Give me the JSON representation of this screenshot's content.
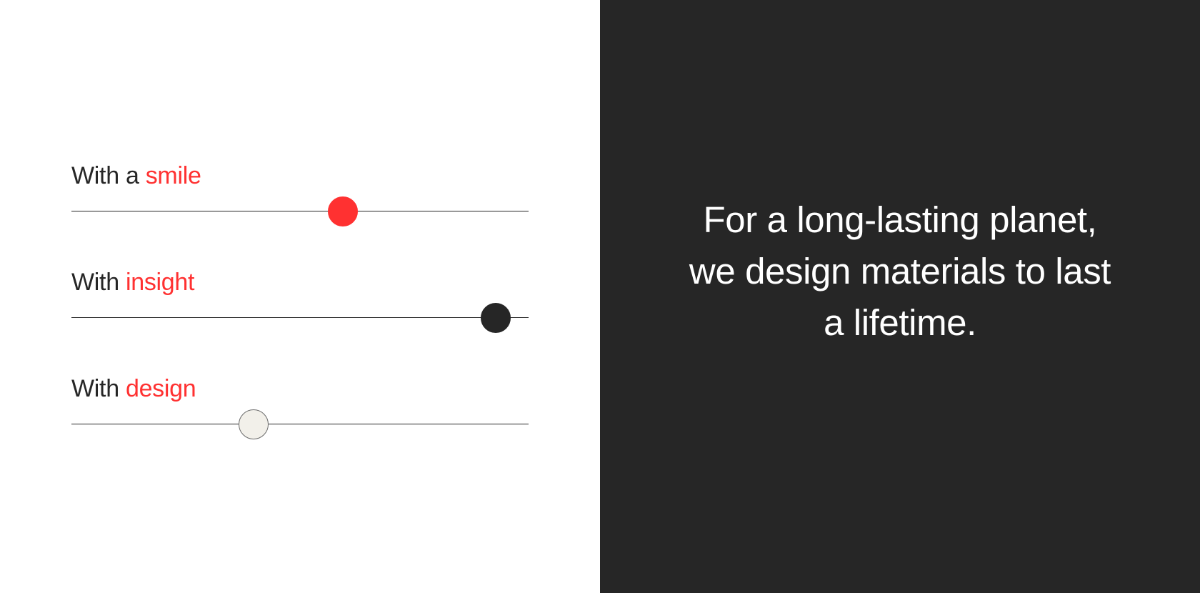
{
  "sliders": [
    {
      "prefix": "With a",
      "accent_word": "smile",
      "value_percent": 59.3,
      "thumb_color": "#ff3131",
      "thumb_border": "#ff3131"
    },
    {
      "prefix": "With",
      "accent_word": "insight",
      "value_percent": 92.8,
      "thumb_color": "#262626",
      "thumb_border": "#262626"
    },
    {
      "prefix": "With",
      "accent_word": "design",
      "value_percent": 39.8,
      "thumb_color": "#f2f0ea",
      "thumb_border": "#6b6b6b"
    }
  ],
  "headline": {
    "line1": "For a long-lasting planet,",
    "line2": "we design materials to last",
    "line3": "a lifetime."
  },
  "colors": {
    "accent": "#ff3131",
    "dark_panel": "#262626",
    "light_panel": "#ffffff",
    "text_dark": "#262626",
    "text_light": "#ffffff"
  }
}
